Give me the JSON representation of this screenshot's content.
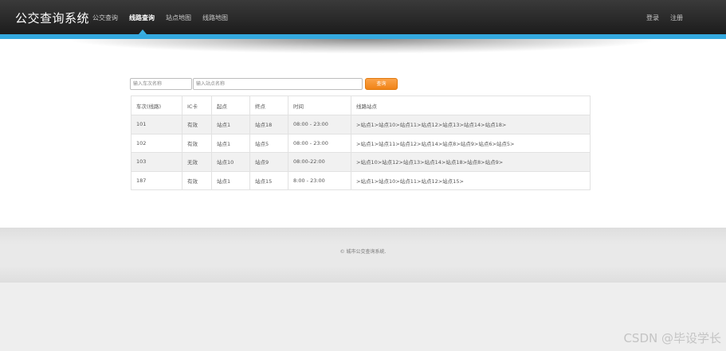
{
  "header": {
    "brand": "公交查询系统",
    "nav": [
      "公交查询",
      "线路查询",
      "站点地图",
      "线路地图"
    ],
    "login": "登录",
    "register": "注册"
  },
  "search": {
    "route_placeholder": "输入车次名称",
    "station_placeholder": "输入站点名称",
    "button": "查询"
  },
  "table": {
    "headers": [
      "车次(线路)",
      "IC卡",
      "起点",
      "终点",
      "时间",
      "线路站点"
    ],
    "rows": [
      [
        "101",
        "有效",
        "站点1",
        "站点18",
        "08:00 - 23:00",
        ">站点1>站点10>站点11>站点12>站点13>站点14>站点18>"
      ],
      [
        "102",
        "有效",
        "站点1",
        "站点5",
        "08:00 - 23:00",
        ">站点1>站点11>站点12>站点14>站点8>站点9>站点6>站点5>"
      ],
      [
        "103",
        "无效",
        "站点10",
        "站点9",
        "08:00-22:00",
        ">站点10>站点12>站点13>站点14>站点18>站点8>站点9>"
      ],
      [
        "187",
        "有效",
        "站点1",
        "站点15",
        "8:00 - 23:00",
        ">站点1>站点10>站点11>站点12>站点15>"
      ]
    ]
  },
  "footer": {
    "copyright": "© 城市公交查询系统."
  },
  "watermark": "CSDN @毕设学长",
  "colors": {
    "accent_blue": "#34a9df",
    "button_orange": "#f08317",
    "header_dark": "#1c1c1c"
  }
}
